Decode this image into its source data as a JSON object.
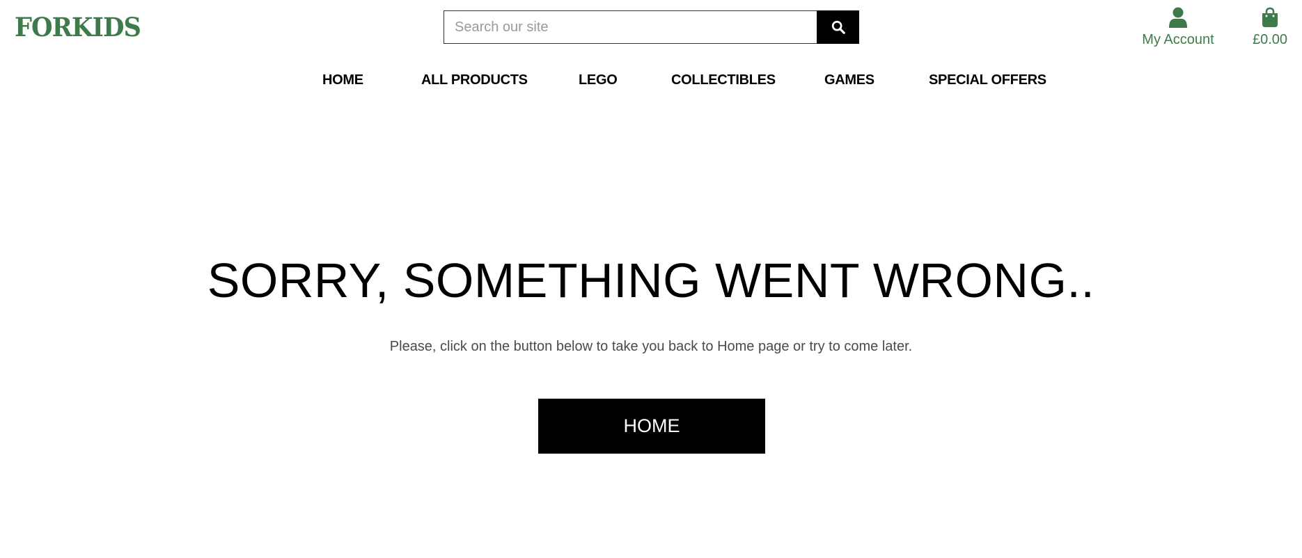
{
  "header": {
    "logo_text": "FORKIDS",
    "brand_color": "#3f7a4b",
    "search": {
      "placeholder": "Search our site",
      "value": "",
      "button_icon": "search-icon"
    },
    "account": {
      "icon": "user-icon",
      "label": "My Account"
    },
    "cart": {
      "icon": "shopping-bag-icon",
      "total": "£0.00"
    }
  },
  "nav": {
    "items": [
      {
        "label": "HOME"
      },
      {
        "label": "ALL PRODUCTS"
      },
      {
        "label": "LEGO"
      },
      {
        "label": "COLLECTIBLES"
      },
      {
        "label": "GAMES"
      },
      {
        "label": "SPECIAL OFFERS"
      }
    ]
  },
  "main": {
    "headline": "SORRY, SOMETHING WENT WRONG..",
    "message": "Please, click on the button below to take you back to Home page or try to come later.",
    "home_button_label": "HOME"
  }
}
